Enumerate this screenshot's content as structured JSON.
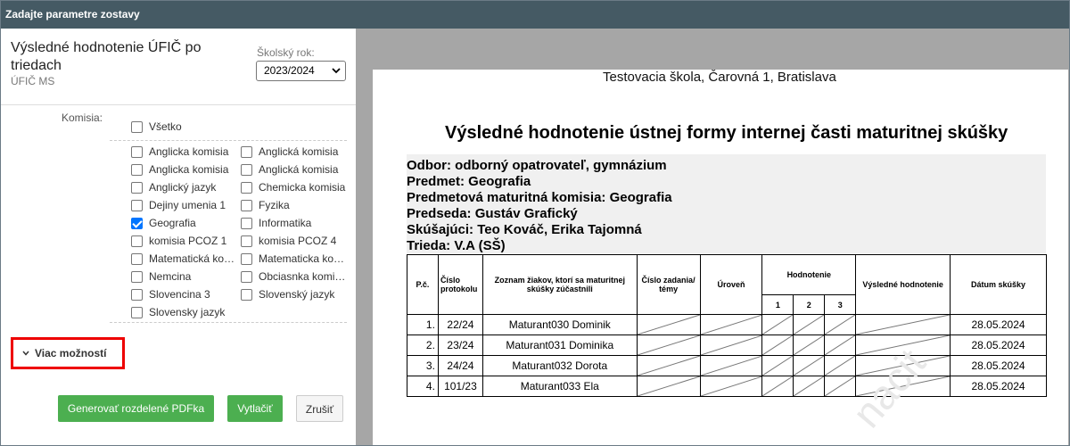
{
  "window": {
    "title": "Zadajte parametre zostavy"
  },
  "report": {
    "title": "Výsledné hodnotenie ÚFIČ po triedach",
    "subtitle": "ÚFIČ MS"
  },
  "school_year": {
    "label": "Školský rok:",
    "value": "2023/2024"
  },
  "commission": {
    "label": "Komisia:",
    "all_label": "Všetko",
    "items": [
      {
        "label": "Anglicka komisia",
        "checked": false
      },
      {
        "label": "Anglická komisia",
        "checked": false
      },
      {
        "label": "Anglicka komisia",
        "checked": false
      },
      {
        "label": "Anglická komisia",
        "checked": false
      },
      {
        "label": "Anglický jazyk",
        "checked": false
      },
      {
        "label": "Chemicka komisia",
        "checked": false
      },
      {
        "label": "Dejiny umenia 1",
        "checked": false
      },
      {
        "label": "Fyzika",
        "checked": false
      },
      {
        "label": "Geografia",
        "checked": true
      },
      {
        "label": "Informatika",
        "checked": false
      },
      {
        "label": "komisia PCOZ 1",
        "checked": false
      },
      {
        "label": "komisia PCOZ 4",
        "checked": false
      },
      {
        "label": "Matematická komisia",
        "checked": false
      },
      {
        "label": "Matematicka komisia",
        "checked": false
      },
      {
        "label": "Nemcina",
        "checked": false
      },
      {
        "label": "Obciasnka komisia",
        "checked": false
      },
      {
        "label": "Slovencina 3",
        "checked": false
      },
      {
        "label": "Slovenský jazyk",
        "checked": false
      },
      {
        "label": "Slovensky jazyk",
        "checked": false
      }
    ]
  },
  "more_options": {
    "label": "Viac možností"
  },
  "buttons": {
    "generate": "Generovať rozdelené PDFka",
    "print": "Vytlačiť",
    "cancel": "Zrušiť"
  },
  "preview": {
    "school": "Testovacia škola, Čarovná 1, Bratislava",
    "title": "Výsledné hodnotenie ústnej formy internej časti maturitnej skúšky",
    "info": [
      "Odbor:  odborný opatrovateľ, gymnázium",
      "Predmet: Geografia",
      "Predmetová maturitná komisia: Geografia",
      "Predseda: Gustáv Grafický",
      "Skúšajúci:  Teo Kováč, Erika Tajomná",
      "Trieda: V.A (SŠ)"
    ],
    "table": {
      "headers": {
        "pc": "P.č.",
        "protocol": "Číslo protokolu",
        "students": "Zoznam žiakov, ktorí sa maturitnej skúšky zúčastnili",
        "assignment": "Číslo zadania/ témy",
        "level": "Úroveň",
        "evaluation": "Hodnotenie",
        "eval1": "1",
        "eval2": "2",
        "eval3": "3",
        "result": "Výsledné hodnotenie",
        "date": "Dátum skúšky"
      },
      "rows": [
        {
          "pc": "1.",
          "protocol": "22/24",
          "student": "Maturant030 Dominik",
          "date": "28.05.2024"
        },
        {
          "pc": "2.",
          "protocol": "23/24",
          "student": "Maturant031 Dominika",
          "date": "28.05.2024"
        },
        {
          "pc": "3.",
          "protocol": "24/24",
          "student": "Maturant032 Dorota",
          "date": "28.05.2024"
        },
        {
          "pc": "4.",
          "protocol": "101/23",
          "student": "Maturant033 Ela",
          "date": "28.05.2024"
        }
      ]
    },
    "watermark": "nacit"
  }
}
